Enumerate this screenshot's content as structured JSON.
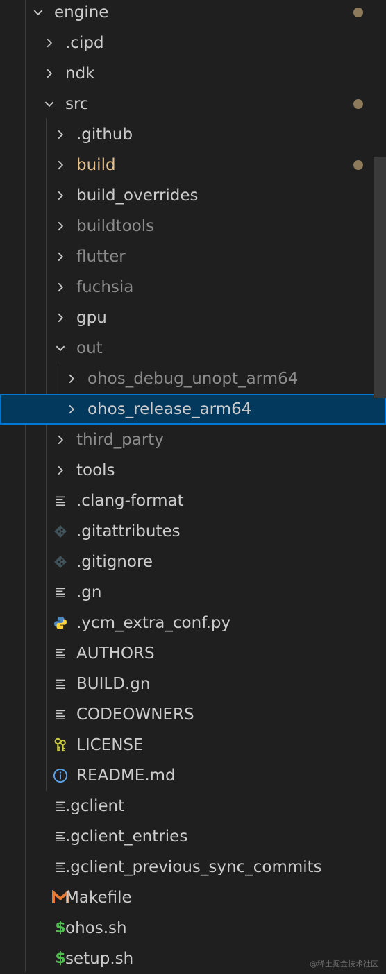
{
  "tree": [
    {
      "label": "engine",
      "kind": "folder",
      "open": true,
      "depth": 0,
      "modified_dot": true
    },
    {
      "label": ".cipd",
      "kind": "folder",
      "open": false,
      "depth": 1
    },
    {
      "label": "ndk",
      "kind": "folder",
      "open": false,
      "depth": 1
    },
    {
      "label": "src",
      "kind": "folder",
      "open": true,
      "depth": 1,
      "modified_dot": true
    },
    {
      "label": ".github",
      "kind": "folder",
      "open": false,
      "depth": 2
    },
    {
      "label": "build",
      "kind": "folder",
      "open": false,
      "depth": 2,
      "modified": true,
      "modified_dot": true
    },
    {
      "label": "build_overrides",
      "kind": "folder",
      "open": false,
      "depth": 2
    },
    {
      "label": "buildtools",
      "kind": "folder",
      "open": false,
      "depth": 2,
      "dim": true
    },
    {
      "label": "flutter",
      "kind": "folder",
      "open": false,
      "depth": 2,
      "dim": true
    },
    {
      "label": "fuchsia",
      "kind": "folder",
      "open": false,
      "depth": 2,
      "dim": true
    },
    {
      "label": "gpu",
      "kind": "folder",
      "open": false,
      "depth": 2
    },
    {
      "label": "out",
      "kind": "folder",
      "open": true,
      "depth": 2,
      "dim": true
    },
    {
      "label": "ohos_debug_unopt_arm64",
      "kind": "folder",
      "open": false,
      "depth": 3,
      "dim": true
    },
    {
      "label": "ohos_release_arm64",
      "kind": "folder",
      "open": false,
      "depth": 3,
      "selected": true
    },
    {
      "label": "third_party",
      "kind": "folder",
      "open": false,
      "depth": 2,
      "dim": true
    },
    {
      "label": "tools",
      "kind": "folder",
      "open": false,
      "depth": 2
    },
    {
      "label": ".clang-format",
      "kind": "file",
      "icon": "lines-icon",
      "depth": 2
    },
    {
      "label": ".gitattributes",
      "kind": "file",
      "icon": "git-icon",
      "depth": 2
    },
    {
      "label": ".gitignore",
      "kind": "file",
      "icon": "git-icon",
      "depth": 2
    },
    {
      "label": ".gn",
      "kind": "file",
      "icon": "lines-icon",
      "depth": 2
    },
    {
      "label": ".ycm_extra_conf.py",
      "kind": "file",
      "icon": "python-icon",
      "depth": 2
    },
    {
      "label": "AUTHORS",
      "kind": "file",
      "icon": "lines-icon",
      "depth": 2
    },
    {
      "label": "BUILD.gn",
      "kind": "file",
      "icon": "lines-icon",
      "depth": 2
    },
    {
      "label": "CODEOWNERS",
      "kind": "file",
      "icon": "lines-icon",
      "depth": 2
    },
    {
      "label": "LICENSE",
      "kind": "file",
      "icon": "license-key-icon",
      "depth": 2
    },
    {
      "label": "README.md",
      "kind": "file",
      "icon": "info-icon",
      "depth": 2
    },
    {
      "label": ".gclient",
      "kind": "file",
      "icon": "lines-icon",
      "depth": 1
    },
    {
      "label": ".gclient_entries",
      "kind": "file",
      "icon": "lines-icon",
      "depth": 1
    },
    {
      "label": ".gclient_previous_sync_commits",
      "kind": "file",
      "icon": "lines-icon",
      "depth": 1
    },
    {
      "label": "Makefile",
      "kind": "file",
      "icon": "makefile-icon",
      "depth": 1
    },
    {
      "label": "ohos.sh",
      "kind": "file",
      "icon": "shell-dollar-icon",
      "depth": 1
    },
    {
      "label": "setup.sh",
      "kind": "file",
      "icon": "shell-dollar-icon",
      "depth": 1
    }
  ],
  "colors": {
    "background": "#1f1f1f",
    "text": "#cccccc",
    "dim_text": "#8c8c8c",
    "modified_text": "#e2c08d",
    "selected_bg": "#04395e",
    "selected_border": "#0078d4",
    "python_blue": "#4b8bbe",
    "python_yellow": "#ffd43b",
    "makefile_orange": "#e37933",
    "shell_green": "#4ec24e",
    "info_blue": "#5aa0e6",
    "key_yellow": "#cbcb41"
  },
  "watermark": "@稀土掘金技术社区"
}
